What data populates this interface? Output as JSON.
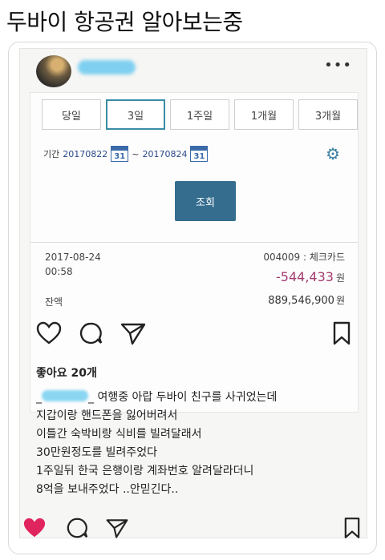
{
  "headline": "두바이 항공권 알아보는중",
  "post": {
    "more_icon": "more-horizontal-icon",
    "bank": {
      "tabs": [
        {
          "label": "당일",
          "active": false
        },
        {
          "label": "3일",
          "active": true
        },
        {
          "label": "1주일",
          "active": false
        },
        {
          "label": "1개월",
          "active": false
        },
        {
          "label": "3개월",
          "active": false
        }
      ],
      "period_label": "기간",
      "date_from": "20170822",
      "date_sep": "~",
      "date_to": "20170824",
      "calendar_day": "31",
      "lookup_button": "조회",
      "transaction": {
        "date": "2017-08-24",
        "time": "00:58",
        "account": "004009 : 체크카드",
        "amount": "-544,433",
        "unit": "원",
        "balance_label": "잔액",
        "balance": "889,546,900",
        "balance_unit": "원"
      }
    },
    "likes": "좋아요 20개",
    "caption": {
      "username_prefix": "_",
      "username_suffix": "_",
      "line1": "여행중 아랍 두바이 친구를 사귀었는데",
      "line2": "지갑이랑 핸드폰을 잃어버려서",
      "line3": "이틀간 숙박비랑 식비를 빌려달래서",
      "line4": "30만원정도를 빌려주었다",
      "line5": "1주일뒤 한국 은행이랑 계좌번호 알려달라더니",
      "line6": "8억을 보내주었다 ..안믿긴다.."
    }
  },
  "colors": {
    "accent": "#356d8f",
    "amount": "#a23b6e",
    "liked": "#e0245e"
  }
}
